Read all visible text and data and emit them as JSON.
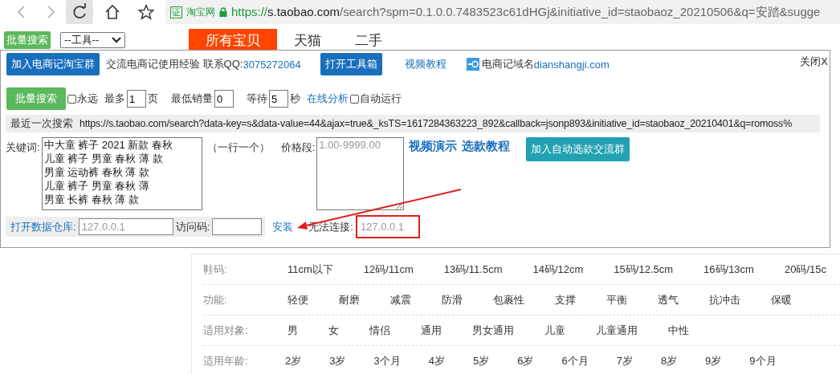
{
  "browser": {
    "badge": "证",
    "site_name": "淘宝网",
    "url": {
      "scheme": "https://",
      "host": "s.taobao.com",
      "path": "/search?spm=0.1.0.0.7483523c61dHGj&initiative_id=staobaoz_20210506&q=安踏&sugge"
    }
  },
  "page_bar": {
    "search_button": "批量搜索",
    "tool_select": "--工具--",
    "tabs": [
      {
        "label": "所有宝贝",
        "selected": true
      },
      {
        "label": "天猫",
        "selected": false
      },
      {
        "label": "二手",
        "selected": false
      }
    ]
  },
  "panel": {
    "join_button": "加入电商记淘宝群",
    "contact_text": "交流电商记使用经验 联系QQ:",
    "qq_link": "3075272064",
    "toolbox_button": "打开工具箱",
    "video_link": "视频教程",
    "domain_label": "电商记域名",
    "domain_link": "dianshangji.com",
    "close": "关闭X",
    "options": {
      "search_button": "批量搜索",
      "forever": {
        "label": "永远",
        "checked": false
      },
      "max_label": "最多",
      "max_value": "1",
      "max_unit": "页",
      "min_sales_label": "最低销量",
      "min_sales_value": "0",
      "wait_label": "等待",
      "wait_value": "5",
      "wait_unit": "秒",
      "analysis_link": "在线分析",
      "auto_run": {
        "label": "自动运行",
        "checked": false
      }
    },
    "last_search": {
      "label": "最近一次搜索",
      "url": "https://s.taobao.com/search?data-key=s&data-value=44&ajax=true&_ksTS=1617284363223_892&callback=jsonp893&initiative_id=staobaoz_20210401&q=romoss%"
    },
    "keywords": {
      "label": "关键词:",
      "lines": [
        "中大童 裤子 2021 新款 春秋",
        "儿童 裤子 男童 春秋 薄 款",
        "男童 运动裤 春秋 薄 款",
        "儿童 裤子 男童 春秋 薄",
        "男童 长裤 春秋 薄 款"
      ],
      "hint": "（一行一个）"
    },
    "price": {
      "label": "价格段:",
      "placeholder": "1.00-9999.00"
    },
    "tutorial_links": [
      "视频演示",
      "选款教程"
    ],
    "group_button": "加入自动选款交流群",
    "warehouse": {
      "link": "打开数据仓库:",
      "address_placeholder": "127.0.0.1",
      "code_label": "访问码:",
      "install_link": "安装",
      "status_label": "无法连接:",
      "status_placeholder": "127.0.0.1"
    }
  },
  "filters": [
    {
      "label": "鞋码:",
      "values": [
        "11cm以下",
        "12码/11cm",
        "13码/11.5cm",
        "14码/12cm",
        "15码/12.5cm",
        "16码/13cm",
        "20码/15c"
      ]
    },
    {
      "label": "功能:",
      "values": [
        "轻便",
        "耐磨",
        "减震",
        "防滑",
        "包裹性",
        "支撑",
        "平衡",
        "透气",
        "抗冲击",
        "保暖"
      ]
    },
    {
      "label": "适用对象:",
      "values": [
        "男",
        "女",
        "情侣",
        "通用",
        "男女通用",
        "儿童",
        "儿童通用",
        "中性"
      ]
    },
    {
      "label": "适用年龄:",
      "values": [
        "2岁",
        "3岁",
        "3个月",
        "4岁",
        "5岁",
        "6岁",
        "6个月",
        "7岁",
        "8岁",
        "9岁",
        "9个月"
      ]
    }
  ]
}
